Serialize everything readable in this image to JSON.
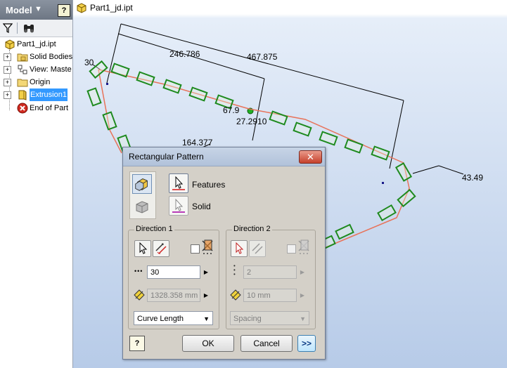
{
  "browser": {
    "title": "Model",
    "help": "?",
    "tree": [
      {
        "label": "Part1_jd.ipt"
      },
      {
        "label": "Solid Bodies"
      },
      {
        "label": "View: Maste"
      },
      {
        "label": "Origin"
      },
      {
        "label": "Extrusion1"
      },
      {
        "label": "End of Part"
      }
    ]
  },
  "document": {
    "tab_label": "Part1_jd.ipt"
  },
  "dimensions": {
    "d1": "246.786",
    "d2": "467.875",
    "d3": "30",
    "d4": "164.377",
    "d5": "43.49",
    "d6": "27.2910",
    "d7": "67.9"
  },
  "dialog": {
    "title": "Rectangular Pattern",
    "features_label": "Features",
    "solid_label": "Solid",
    "direction1": {
      "title": "Direction 1",
      "count": "30",
      "length": "1328.358 mm",
      "method": "Curve Length"
    },
    "direction2": {
      "title": "Direction 2",
      "count": "2",
      "length": "10 mm",
      "method": "Spacing"
    },
    "ok": "OK",
    "cancel": "Cancel",
    "more": ">>",
    "help": "?"
  },
  "colors": {
    "path_line": "#e8735a",
    "block_stroke": "#1e8a1e",
    "dim_line": "#000000",
    "background_top": "#ffffff",
    "background_bottom": "#b7cbe8"
  }
}
